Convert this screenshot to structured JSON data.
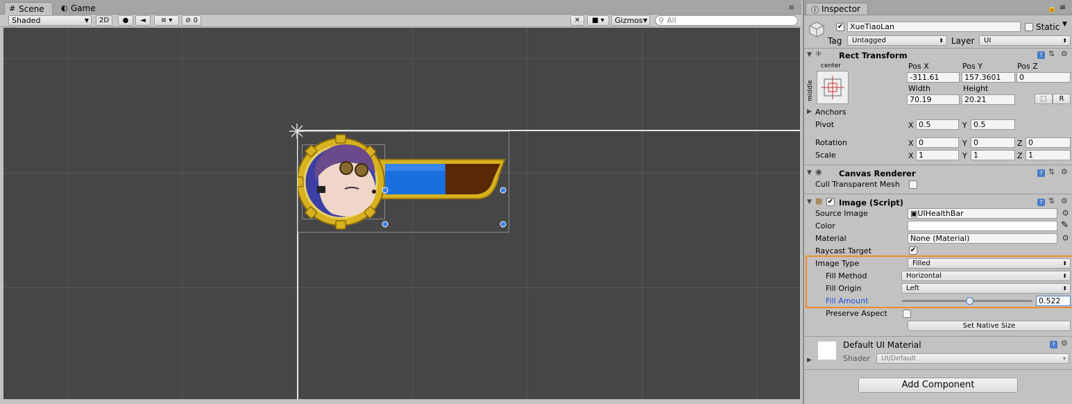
{
  "scene": {
    "tabs": [
      {
        "label": "Scene"
      },
      {
        "label": "Game"
      }
    ],
    "toolbar": {
      "shading": "Shaded",
      "mode_2d": "2D",
      "effects_count": "0",
      "gizmos": "Gizmos",
      "search_placeholder": "All"
    }
  },
  "inspector": {
    "tab_label": "Inspector",
    "object": {
      "name": "XueTiaoLan",
      "active": true,
      "static_label": "Static",
      "tag_label": "Tag",
      "tag_value": "Untagged",
      "layer_label": "Layer",
      "layer_value": "UI"
    },
    "rect_transform": {
      "title": "Rect Transform",
      "anchor_h": "center",
      "anchor_v": "middle",
      "pos_x_label": "Pos X",
      "pos_y_label": "Pos Y",
      "pos_z_label": "Pos Z",
      "pos_x": "-311.61",
      "pos_y": "157.3601",
      "pos_z": "0",
      "width_label": "Width",
      "height_label": "Height",
      "width": "70.19",
      "height": "20.21",
      "r_button": "R",
      "anchors_label": "Anchors",
      "pivot_label": "Pivot",
      "pivot_x": "0.5",
      "pivot_y": "0.5",
      "rotation_label": "Rotation",
      "rot_x": "0",
      "rot_y": "0",
      "rot_z": "0",
      "scale_label": "Scale",
      "scale_x": "1",
      "scale_y": "1",
      "scale_z": "1",
      "x": "X",
      "y": "Y",
      "z": "Z"
    },
    "canvas_renderer": {
      "title": "Canvas Renderer",
      "cull_label": "Cull Transparent Mesh"
    },
    "image": {
      "title": "Image (Script)",
      "source_label": "Source Image",
      "source_value": "UIHealthBar",
      "color_label": "Color",
      "material_label": "Material",
      "material_value": "None (Material)",
      "raycast_label": "Raycast Target",
      "image_type_label": "Image Type",
      "image_type_value": "Filled",
      "fill_method_label": "Fill Method",
      "fill_method_value": "Horizontal",
      "fill_origin_label": "Fill Origin",
      "fill_origin_value": "Left",
      "fill_amount_label": "Fill Amount",
      "fill_amount_value": "0.522",
      "fill_amount": 0.522,
      "preserve_label": "Preserve Aspect",
      "native_size_button": "Set Native Size"
    },
    "material": {
      "title": "Default UI Material",
      "shader_label": "Shader",
      "shader_value": "UI/Default"
    },
    "add_component": "Add Component"
  },
  "colors": {
    "highlight": "#f08a24",
    "fill_blue": "#1a6fe0",
    "bar_brown": "#5a2a06",
    "gold": "#d8b21e",
    "link_blue": "#1a4fd0"
  }
}
